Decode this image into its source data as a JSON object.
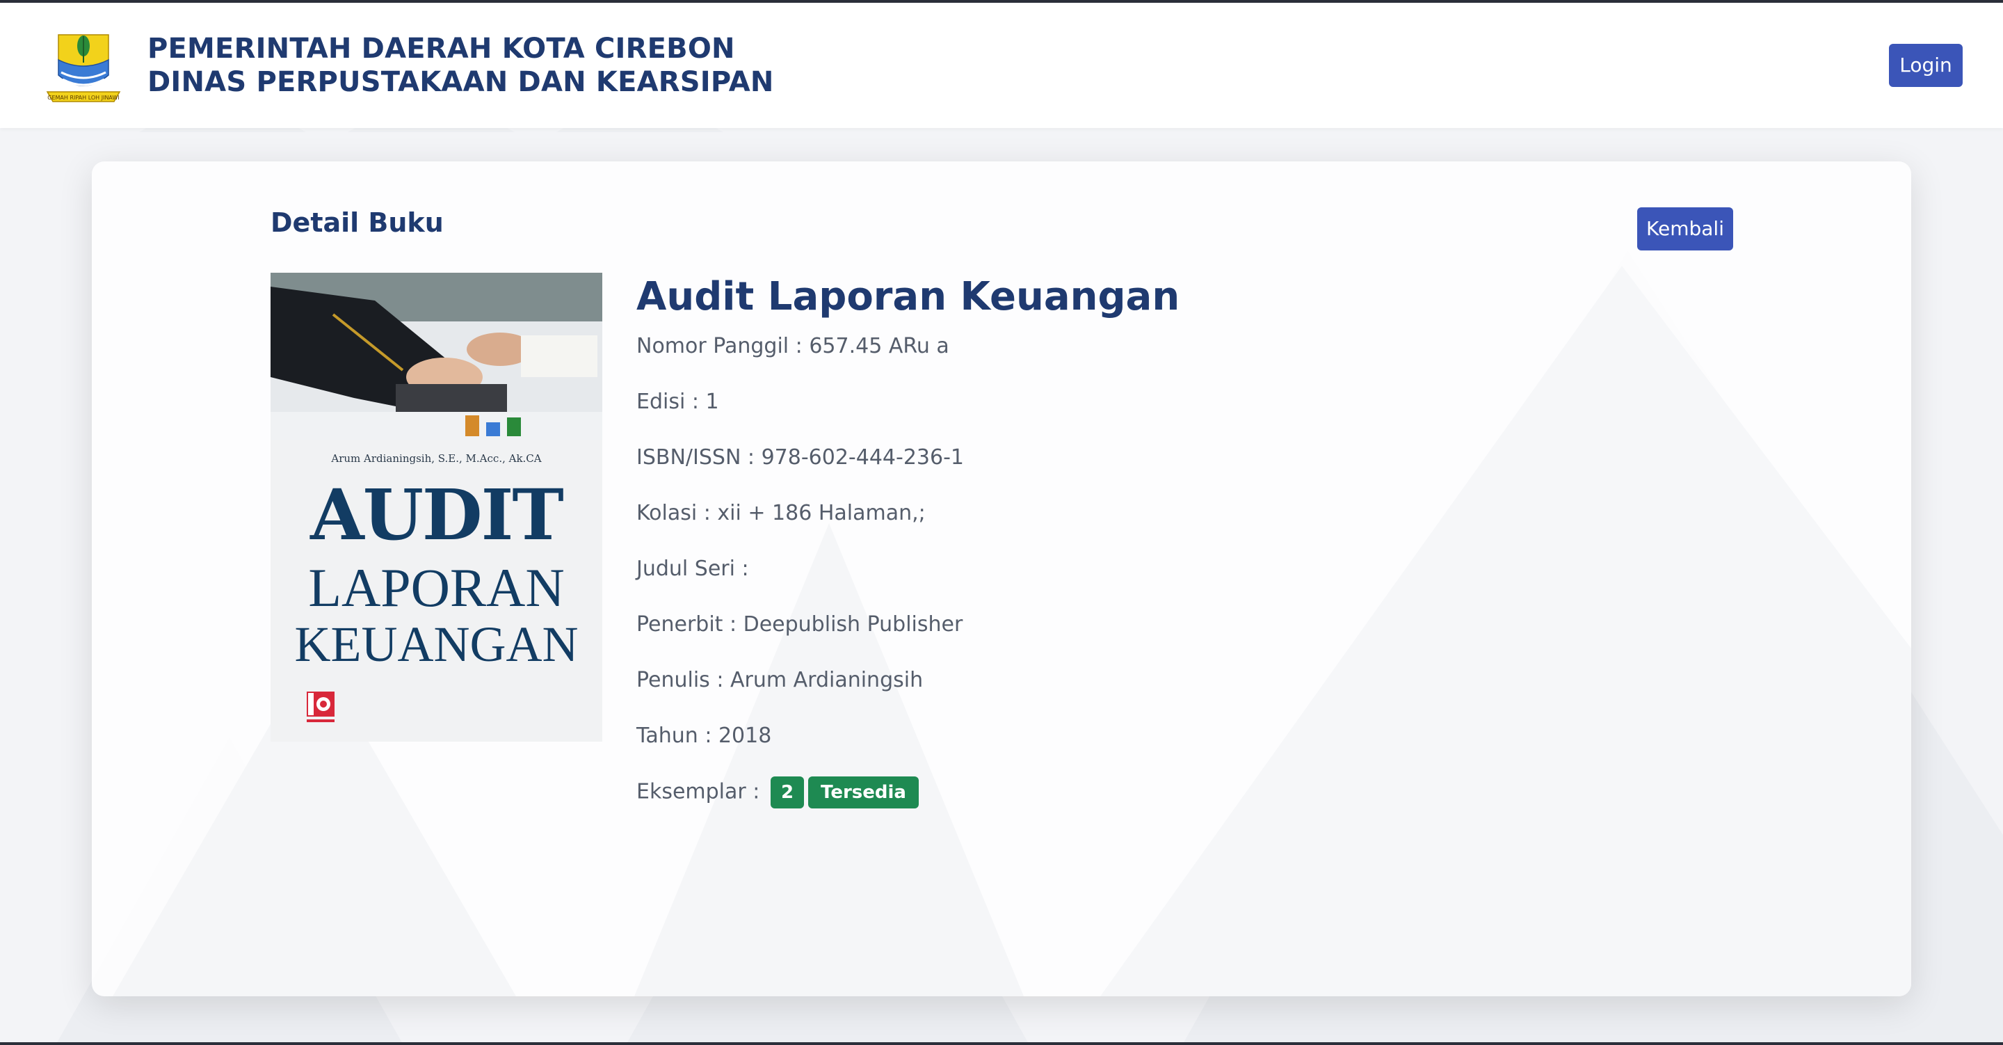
{
  "header": {
    "org_line1": "PEMERINTAH DAERAH KOTA CIREBON",
    "org_line2": "DINAS PERPUSTAKAAN DAN KEARSIPAN",
    "login_label": "Login",
    "logo_icon": "cirebon-crest-icon"
  },
  "page": {
    "title": "Detail Buku",
    "back_label": "Kembali"
  },
  "book": {
    "title": "Audit Laporan Keuangan",
    "cover": {
      "author": "Arum Ardianingsih, S.E., M.Acc., Ak.CA",
      "title_line1": "AUDIT",
      "title_line2": "LAPORAN",
      "title_line3": "KEUANGAN"
    },
    "fields": [
      {
        "label": "Nomor Panggil :",
        "value": " 657.45 ARu a"
      },
      {
        "label": "Edisi :",
        "value": " 1"
      },
      {
        "label": "ISBN/ISSN :",
        "value": " 978-602-444-236-1"
      },
      {
        "label": "Kolasi :",
        "value": " xii + 186 Halaman,;"
      },
      {
        "label": "Judul Seri :",
        "value": ""
      },
      {
        "label": "Penerbit :",
        "value": " Deepublish Publisher"
      },
      {
        "label": "Penulis :",
        "value": " Arum Ardianingsih"
      },
      {
        "label": "Tahun :",
        "value": " 2018"
      }
    ],
    "eksemplar": {
      "label": "Eksemplar :",
      "count": "2",
      "status": "Tersedia"
    }
  },
  "colors": {
    "brand_text": "#1f3a70",
    "button": "#3b55b8",
    "badge_green": "#1e8a52"
  }
}
